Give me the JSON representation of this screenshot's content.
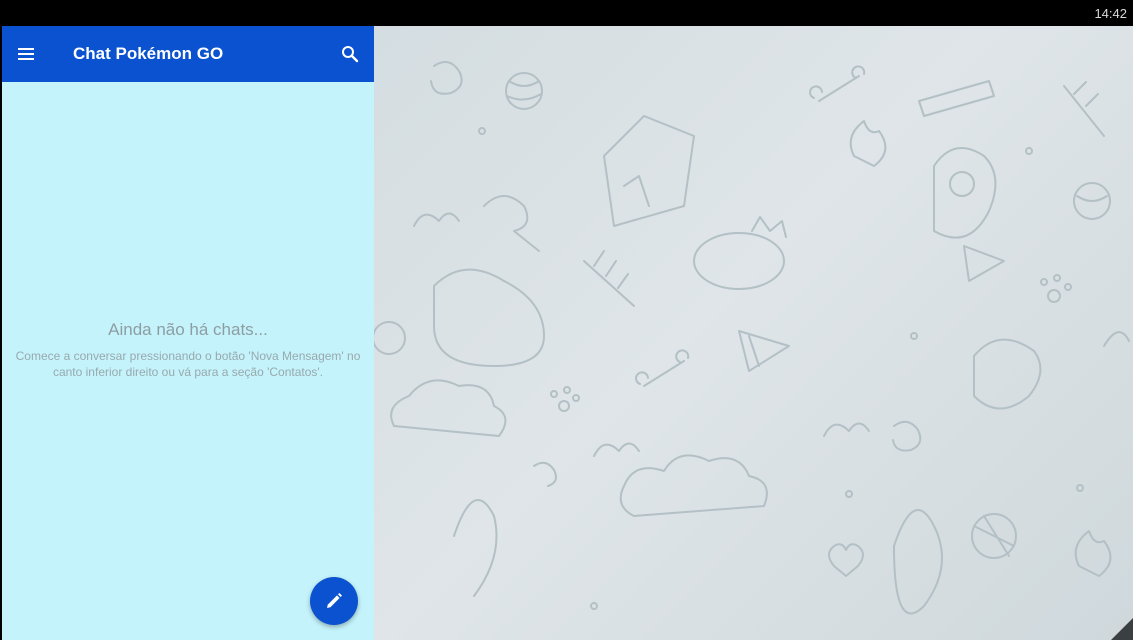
{
  "status_bar": {
    "time": "14:42"
  },
  "app_bar": {
    "title": "Chat Pokémon GO",
    "menu_icon": "hamburger-menu-icon",
    "search_icon": "search-icon",
    "color": "#0a52cf"
  },
  "empty_state": {
    "title": "Ainda não há chats...",
    "description": "Comece a conversar pressionando o botão 'Nova Mensagem' no canto inferior direito ou vá para a seção 'Contatos'."
  },
  "fab": {
    "icon": "pencil-icon"
  },
  "theme": {
    "panel_bg": "#c4f3fb",
    "chat_bg": "#d9e1e4",
    "doodle_stroke": "#b3c0c6"
  }
}
